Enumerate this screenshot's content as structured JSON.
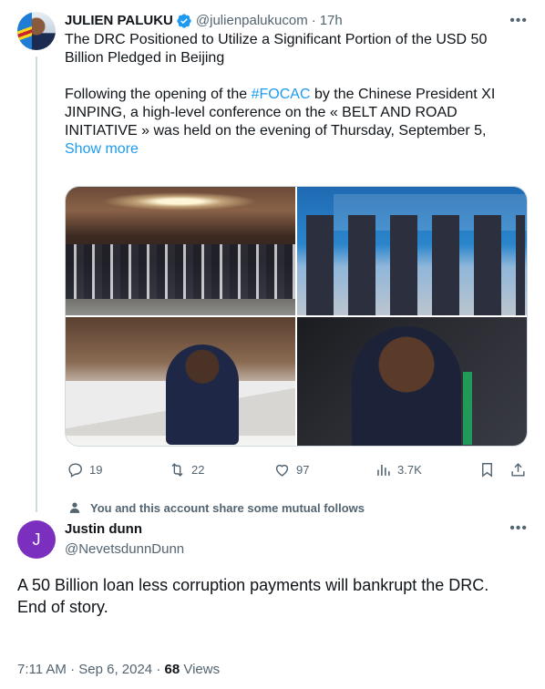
{
  "tweet": {
    "author_name": "JULIEN PALUKU",
    "handle": "@julienpalukucom",
    "time": "17h",
    "title_text": "The DRC Positioned to Utilize a Significant Portion of the USD 50 Billion Pledged in Beijing",
    "body_pre": "Following the opening of the ",
    "hashtag": "#FOCAC",
    "body_post": " by the Chinese President XI JINPING, a high-level conference on the « BELT AND ROAD INITIATIVE » was held on the evening of Thursday, September 5,",
    "show_more": "Show more",
    "stats": {
      "replies": "19",
      "reposts": "22",
      "likes": "97",
      "views": "3.7K"
    }
  },
  "mutual_follow_text": "You and this account share some mutual follows",
  "reply": {
    "avatar_letter": "J",
    "author_name": "Justin dunn",
    "handle": "@NevetsdunnDunn",
    "text_line1": "A 50 Billion loan less corruption payments will bankrupt the DRC.",
    "text_line2": "End of story."
  },
  "reply_meta": {
    "timestamp": "7:11 AM · Sep 6, 2024 · ",
    "views_count": "68",
    "views_label": " Views"
  },
  "colors": {
    "accent": "#1d9bf0",
    "text": "#0f1419",
    "secondary": "#536471",
    "reply_avatar": "#7b2fbe"
  },
  "icons": [
    "verified-badge-icon",
    "more-icon",
    "reply-icon",
    "repost-icon",
    "like-icon",
    "views-icon",
    "bookmark-icon",
    "share-icon",
    "person-icon"
  ]
}
